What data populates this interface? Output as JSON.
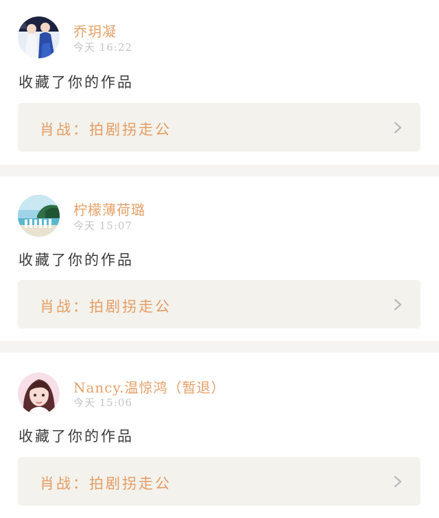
{
  "notifications": [
    {
      "username": "乔玥凝",
      "timestamp": "今天 16:22",
      "action": "收藏了你的作品",
      "work_title": "肖战：拍剧拐走公",
      "avatar": "avatar-two-people-in-blue-costumes"
    },
    {
      "username": "柠檬薄荷璐",
      "timestamp": "今天 15:07",
      "action": "收藏了你的作品",
      "work_title": "肖战：拍剧拐走公",
      "avatar": "avatar-group-on-beach"
    },
    {
      "username": "Nancy.温惊鸿（暂退）",
      "timestamp": "今天 15:06",
      "action": "收藏了你的作品",
      "work_title": "肖战：拍剧拐走公",
      "avatar": "avatar-girl-portrait"
    }
  ],
  "icons": {
    "chevron": "chevron-right-icon"
  },
  "colors": {
    "username": "#e5a067",
    "timestamp": "#c4c4c4",
    "action_text": "#3a3a3a",
    "work_card_bg": "#f3f2ec",
    "work_title": "#e49c63",
    "divider": "#f5f4f2"
  }
}
